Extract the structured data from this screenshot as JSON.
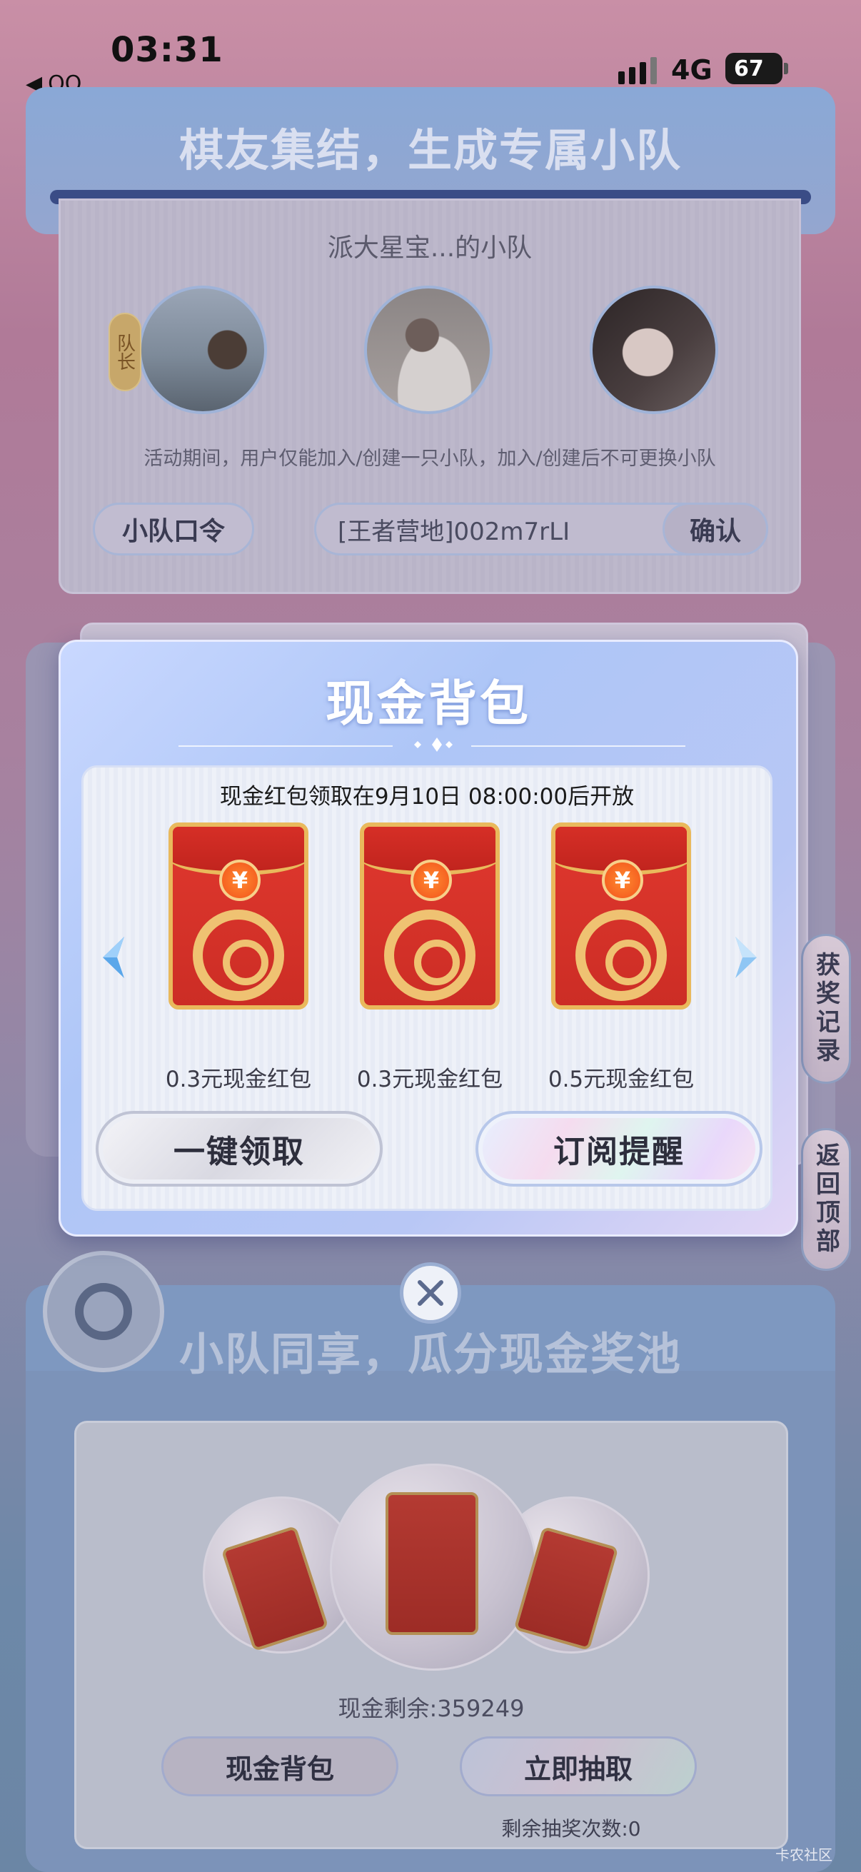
{
  "status_bar": {
    "time": "03:31",
    "back_label": "QQ",
    "network": "4G",
    "battery": "67"
  },
  "team_card": {
    "title": "棋友集结，生成专属小队",
    "team_name": "派大星宝...的小队",
    "captain_label": "队长",
    "rule_text": "活动期间，用户仅能加入/创建一只小队，加入/创建后不可更换小队",
    "code_label": "小队口令",
    "code_value": "[王者营地]002m7rLI",
    "confirm_label": "确认"
  },
  "side_buttons": {
    "record": "获奖记录",
    "back_top": "返回顶部"
  },
  "popup": {
    "title": "现金背包",
    "open_notice": "现金红包领取在9月10日 08:00:00后开放",
    "envelopes": [
      {
        "label": "0.3元现金红包",
        "coin": "¥"
      },
      {
        "label": "0.3元现金红包",
        "coin": "¥"
      },
      {
        "label": "0.5元现金红包",
        "coin": "¥"
      }
    ],
    "claim_all": "一键领取",
    "subscribe": "订阅提醒"
  },
  "pool_card": {
    "title": "小队同享，瓜分现金奖池",
    "cash_left": "现金剩余:359249",
    "bag_button": "现金背包",
    "draw_button": "立即抽取",
    "draws_left": "剩余抽奖次数:0"
  },
  "watermark": "卡农社区",
  "colors": {
    "envelope_red": "#d8342a",
    "envelope_gold": "#e9b95c",
    "popup_blue": "#aec6f7"
  }
}
